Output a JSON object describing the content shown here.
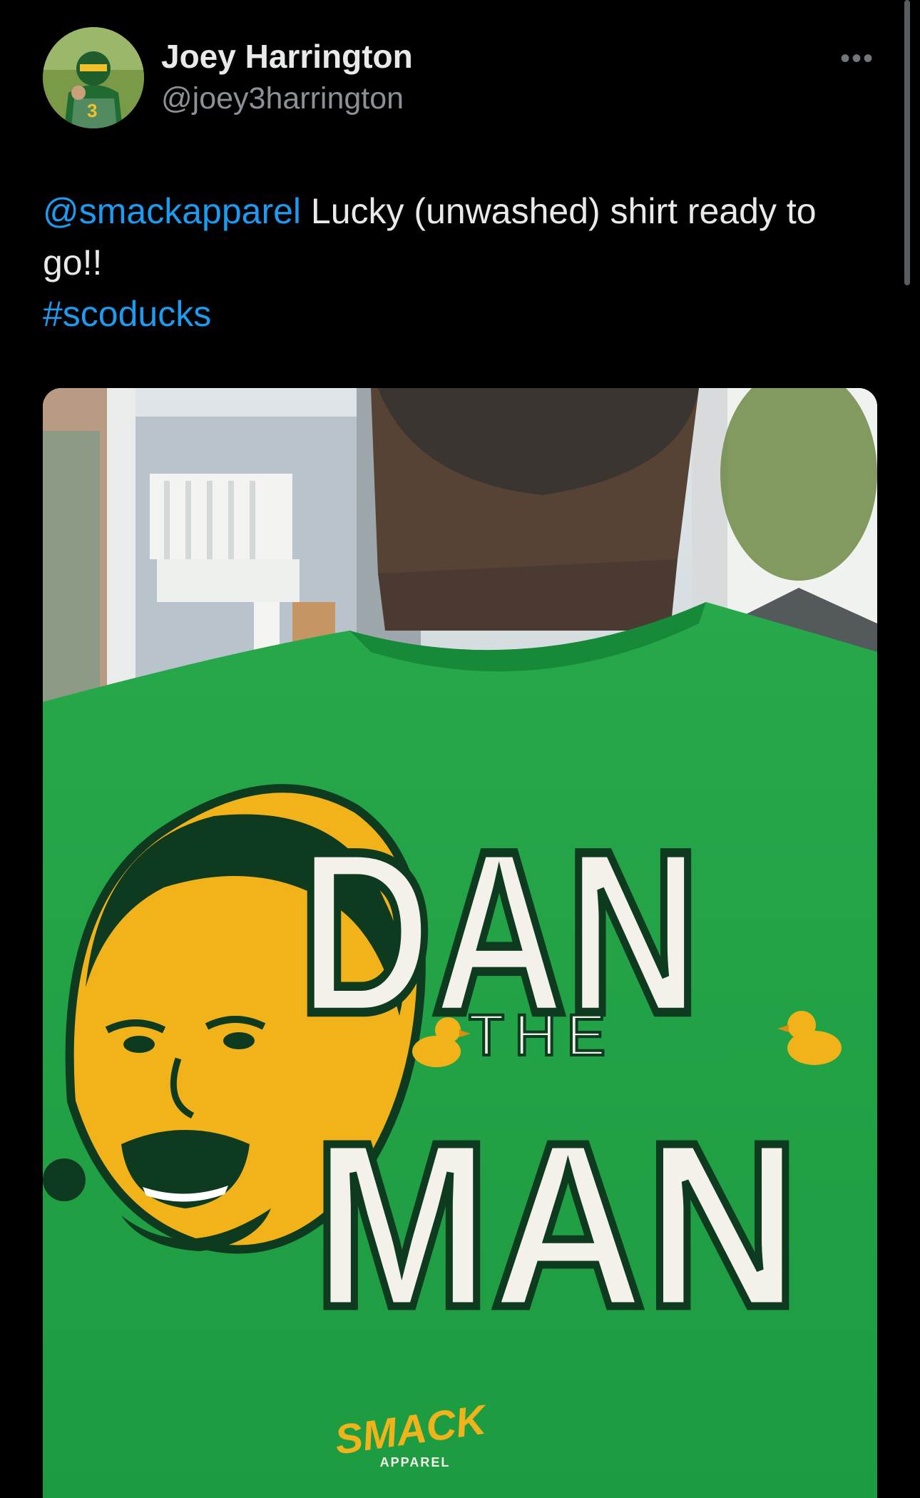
{
  "tweet": {
    "author_name": "Joey Harrington",
    "author_handle": "@joey3harrington",
    "more_icon": "more-horizontal-icon",
    "mention": "@smackapparel",
    "body": " Lucky (unwashed) shirt ready to go!!",
    "hashtag": "#scoducks"
  },
  "shirt": {
    "line1": "DAN",
    "line2": "THE",
    "line3": "MAN",
    "brand": "SMACK",
    "brand_sub": "APPAREL"
  },
  "colors": {
    "background": "#000000",
    "text": "#e7e9ea",
    "secondary": "#8b9197",
    "link": "#1d9bf0",
    "shirt_green": "#1fa046",
    "oregon_yellow": "#f2b21a"
  }
}
